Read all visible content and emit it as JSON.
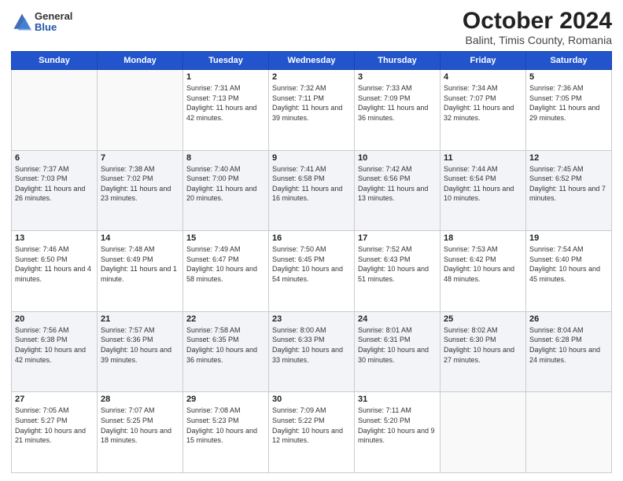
{
  "logo": {
    "general": "General",
    "blue": "Blue"
  },
  "title": {
    "month": "October 2024",
    "location": "Balint, Timis County, Romania"
  },
  "header_days": [
    "Sunday",
    "Monday",
    "Tuesday",
    "Wednesday",
    "Thursday",
    "Friday",
    "Saturday"
  ],
  "weeks": [
    [
      {
        "day": "",
        "info": ""
      },
      {
        "day": "",
        "info": ""
      },
      {
        "day": "1",
        "info": "Sunrise: 7:31 AM\nSunset: 7:13 PM\nDaylight: 11 hours and 42 minutes."
      },
      {
        "day": "2",
        "info": "Sunrise: 7:32 AM\nSunset: 7:11 PM\nDaylight: 11 hours and 39 minutes."
      },
      {
        "day": "3",
        "info": "Sunrise: 7:33 AM\nSunset: 7:09 PM\nDaylight: 11 hours and 36 minutes."
      },
      {
        "day": "4",
        "info": "Sunrise: 7:34 AM\nSunset: 7:07 PM\nDaylight: 11 hours and 32 minutes."
      },
      {
        "day": "5",
        "info": "Sunrise: 7:36 AM\nSunset: 7:05 PM\nDaylight: 11 hours and 29 minutes."
      }
    ],
    [
      {
        "day": "6",
        "info": "Sunrise: 7:37 AM\nSunset: 7:03 PM\nDaylight: 11 hours and 26 minutes."
      },
      {
        "day": "7",
        "info": "Sunrise: 7:38 AM\nSunset: 7:02 PM\nDaylight: 11 hours and 23 minutes."
      },
      {
        "day": "8",
        "info": "Sunrise: 7:40 AM\nSunset: 7:00 PM\nDaylight: 11 hours and 20 minutes."
      },
      {
        "day": "9",
        "info": "Sunrise: 7:41 AM\nSunset: 6:58 PM\nDaylight: 11 hours and 16 minutes."
      },
      {
        "day": "10",
        "info": "Sunrise: 7:42 AM\nSunset: 6:56 PM\nDaylight: 11 hours and 13 minutes."
      },
      {
        "day": "11",
        "info": "Sunrise: 7:44 AM\nSunset: 6:54 PM\nDaylight: 11 hours and 10 minutes."
      },
      {
        "day": "12",
        "info": "Sunrise: 7:45 AM\nSunset: 6:52 PM\nDaylight: 11 hours and 7 minutes."
      }
    ],
    [
      {
        "day": "13",
        "info": "Sunrise: 7:46 AM\nSunset: 6:50 PM\nDaylight: 11 hours and 4 minutes."
      },
      {
        "day": "14",
        "info": "Sunrise: 7:48 AM\nSunset: 6:49 PM\nDaylight: 11 hours and 1 minute."
      },
      {
        "day": "15",
        "info": "Sunrise: 7:49 AM\nSunset: 6:47 PM\nDaylight: 10 hours and 58 minutes."
      },
      {
        "day": "16",
        "info": "Sunrise: 7:50 AM\nSunset: 6:45 PM\nDaylight: 10 hours and 54 minutes."
      },
      {
        "day": "17",
        "info": "Sunrise: 7:52 AM\nSunset: 6:43 PM\nDaylight: 10 hours and 51 minutes."
      },
      {
        "day": "18",
        "info": "Sunrise: 7:53 AM\nSunset: 6:42 PM\nDaylight: 10 hours and 48 minutes."
      },
      {
        "day": "19",
        "info": "Sunrise: 7:54 AM\nSunset: 6:40 PM\nDaylight: 10 hours and 45 minutes."
      }
    ],
    [
      {
        "day": "20",
        "info": "Sunrise: 7:56 AM\nSunset: 6:38 PM\nDaylight: 10 hours and 42 minutes."
      },
      {
        "day": "21",
        "info": "Sunrise: 7:57 AM\nSunset: 6:36 PM\nDaylight: 10 hours and 39 minutes."
      },
      {
        "day": "22",
        "info": "Sunrise: 7:58 AM\nSunset: 6:35 PM\nDaylight: 10 hours and 36 minutes."
      },
      {
        "day": "23",
        "info": "Sunrise: 8:00 AM\nSunset: 6:33 PM\nDaylight: 10 hours and 33 minutes."
      },
      {
        "day": "24",
        "info": "Sunrise: 8:01 AM\nSunset: 6:31 PM\nDaylight: 10 hours and 30 minutes."
      },
      {
        "day": "25",
        "info": "Sunrise: 8:02 AM\nSunset: 6:30 PM\nDaylight: 10 hours and 27 minutes."
      },
      {
        "day": "26",
        "info": "Sunrise: 8:04 AM\nSunset: 6:28 PM\nDaylight: 10 hours and 24 minutes."
      }
    ],
    [
      {
        "day": "27",
        "info": "Sunrise: 7:05 AM\nSunset: 5:27 PM\nDaylight: 10 hours and 21 minutes."
      },
      {
        "day": "28",
        "info": "Sunrise: 7:07 AM\nSunset: 5:25 PM\nDaylight: 10 hours and 18 minutes."
      },
      {
        "day": "29",
        "info": "Sunrise: 7:08 AM\nSunset: 5:23 PM\nDaylight: 10 hours and 15 minutes."
      },
      {
        "day": "30",
        "info": "Sunrise: 7:09 AM\nSunset: 5:22 PM\nDaylight: 10 hours and 12 minutes."
      },
      {
        "day": "31",
        "info": "Sunrise: 7:11 AM\nSunset: 5:20 PM\nDaylight: 10 hours and 9 minutes."
      },
      {
        "day": "",
        "info": ""
      },
      {
        "day": "",
        "info": ""
      }
    ]
  ]
}
